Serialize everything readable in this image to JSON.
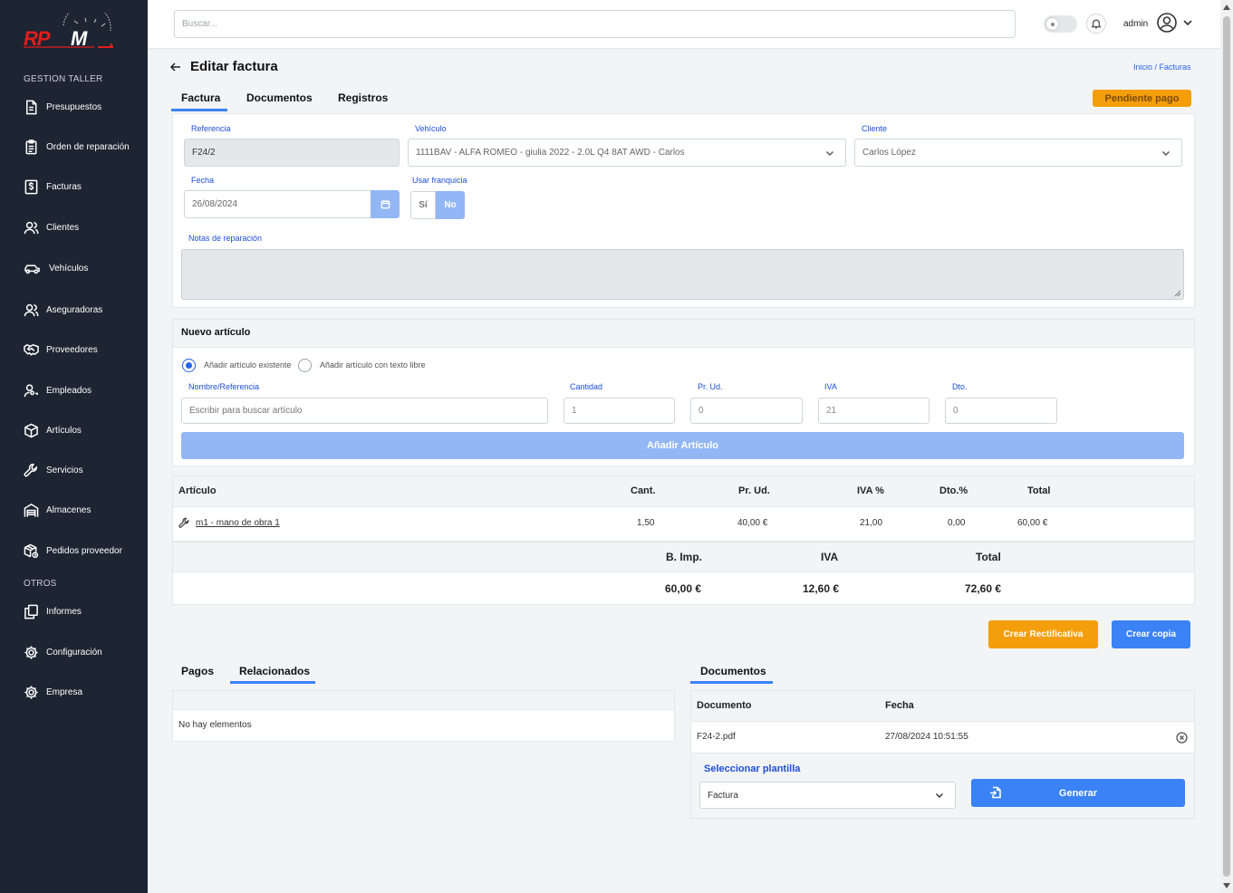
{
  "brand": {
    "logo_text": "RPM"
  },
  "sidebar": {
    "section_taller": "GESTION TALLER",
    "section_otros": "OTROS",
    "items": [
      {
        "label": "Presupuestos",
        "icon": "document-icon"
      },
      {
        "label": "Orden de reparación",
        "icon": "clipboard-icon"
      },
      {
        "label": "Facturas",
        "icon": "invoice-dollar-icon"
      },
      {
        "label": "Clientes",
        "icon": "users-icon"
      },
      {
        "label": "Vehículos",
        "icon": "car-icon"
      },
      {
        "label": "Aseguradoras",
        "icon": "users-icon"
      },
      {
        "label": "Proveedores",
        "icon": "handshake-icon"
      },
      {
        "label": "Empleados",
        "icon": "user-key-icon"
      },
      {
        "label": "Artículos",
        "icon": "box-icon"
      },
      {
        "label": "Servicios",
        "icon": "wrench-icon"
      },
      {
        "label": "Almacenes",
        "icon": "warehouse-icon"
      },
      {
        "label": "Pedidos proveedor",
        "icon": "package-icon"
      },
      {
        "label": "Informes",
        "icon": "copy-icon"
      },
      {
        "label": "Configuración",
        "icon": "gear-icon"
      },
      {
        "label": "Empresa",
        "icon": "gear-icon"
      }
    ]
  },
  "topbar": {
    "search_placeholder": "Buscar...",
    "user": "admin"
  },
  "page": {
    "title": "Editar factura",
    "breadcrumb": "Inicio  / Facturas",
    "tabs": [
      "Factura",
      "Documentos",
      "Registros"
    ],
    "status_badge": "Pendiente pago",
    "status_color": "#f59e0b"
  },
  "form": {
    "referencia_label": "Referencia",
    "referencia_value": "F24/2",
    "vehiculo_label": "Vehículo",
    "vehiculo_value": "1111BAV - ALFA ROMEO - giulia 2022 - 2.0L Q4 8AT AWD - Carlos",
    "cliente_label": "Cliente",
    "cliente_value": "Carlos López",
    "fecha_label": "Fecha",
    "fecha_value": "26/08/2024",
    "franquicia_label": "Usar franquicia",
    "franquicia_si": "Sí",
    "franquicia_no": "No",
    "notas_label": "Notas de reparación"
  },
  "nuevo_articulo": {
    "title": "Nuevo artículo",
    "radio_existente": "Añadir artículo existente",
    "radio_libre": "Añadir artículo con texto libre",
    "nombre_label": "Nombre/Referencia",
    "nombre_placeholder": "Escribir para buscar artículo",
    "cantidad_label": "Cantidad",
    "cantidad_value": "1",
    "precio_label": "Pr. Ud.",
    "precio_value": "0",
    "iva_label": "IVA",
    "iva_value": "21",
    "dto_label": "Dto.",
    "dto_value": "0",
    "add_button": "Añadir Artículo"
  },
  "articles_table": {
    "headers": [
      "Artículo",
      "Cant.",
      "Pr. Ud.",
      "IVA %",
      "Dto.%",
      "Total"
    ],
    "rows": [
      {
        "articulo": "m1 - mano de obra 1",
        "cant": "1,50",
        "precio": "40,00 €",
        "iva": "21,00",
        "dto": "0,00",
        "total": "60,00 €"
      }
    ]
  },
  "totals": {
    "headers": [
      "B. Imp.",
      "IVA",
      "Total"
    ],
    "values": [
      "60,00 €",
      "12,60 €",
      "72,60 €"
    ]
  },
  "actions": {
    "rectificativa": "Crear Rectificativa",
    "copia": "Crear copia",
    "rectificativa_color": "#f59e0b",
    "copia_color": "#3b82f6"
  },
  "bottom_left": {
    "tabs": [
      "Pagos",
      "Relacionados"
    ],
    "empty_text": "No hay elementos"
  },
  "bottom_right": {
    "tab": "Documentos",
    "headers": [
      "Documento",
      "Fecha"
    ],
    "rows": [
      {
        "documento": "F24-2.pdf",
        "fecha": "27/08/2024 10:51:55"
      }
    ],
    "plantilla_label": "Seleccionar plantilla",
    "plantilla_value": "Factura",
    "generar_button": "Generar"
  }
}
